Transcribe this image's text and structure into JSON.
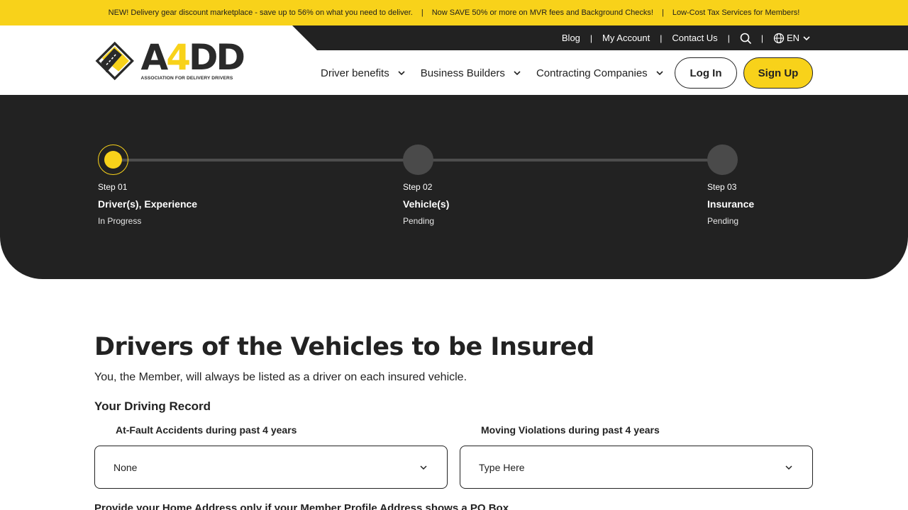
{
  "announcement": {
    "items": [
      "NEW! Delivery gear discount marketplace - save up to 56% on what you need to deliver.",
      "Now SAVE 50% or more on MVR fees and Background Checks!",
      "Low-Cost Tax Services for Members!"
    ],
    "separator": "|"
  },
  "utility_nav": {
    "blog": "Blog",
    "my_account": "My Account",
    "contact_us": "Contact Us",
    "language": "EN",
    "separator": "|",
    "icons": [
      "search-icon",
      "globe-icon",
      "chevron-down-icon"
    ]
  },
  "logo": {
    "text_a": "A",
    "text_4": "4",
    "text_dd": "DD",
    "tagline": "ASSOCIATION FOR DELIVERY DRIVERS"
  },
  "main_nav": {
    "items": [
      {
        "label": "Driver benefits"
      },
      {
        "label": "Business Builders"
      },
      {
        "label": "Contracting Companies"
      }
    ],
    "login": "Log In",
    "signup": "Sign Up"
  },
  "stepper": {
    "steps": [
      {
        "label": "Step 01",
        "title": "Driver(s), Experience",
        "status": "In Progress",
        "active": true
      },
      {
        "label": "Step 02",
        "title": "Vehicle(s)",
        "status": "Pending",
        "active": false
      },
      {
        "label": "Step 03",
        "title": "Insurance",
        "status": "Pending",
        "active": false
      }
    ]
  },
  "form": {
    "title": "Drivers of the Vehicles to be Insured",
    "subtitle": "You, the Member, will always be listed as a driver on each insured vehicle.",
    "section_title": "Your Driving Record",
    "fields": [
      {
        "label": "At-Fault Accidents during past 4 years",
        "value": "None"
      },
      {
        "label": "Moving Violations during past 4 years",
        "placeholder": "Type Here"
      }
    ],
    "next_section": "Provide your Home Address only if your Member Profile Address shows a PO Box"
  },
  "colors": {
    "brand_yellow": "#f8d21a",
    "dark": "#222222",
    "step_inactive": "#4a4a4a"
  }
}
